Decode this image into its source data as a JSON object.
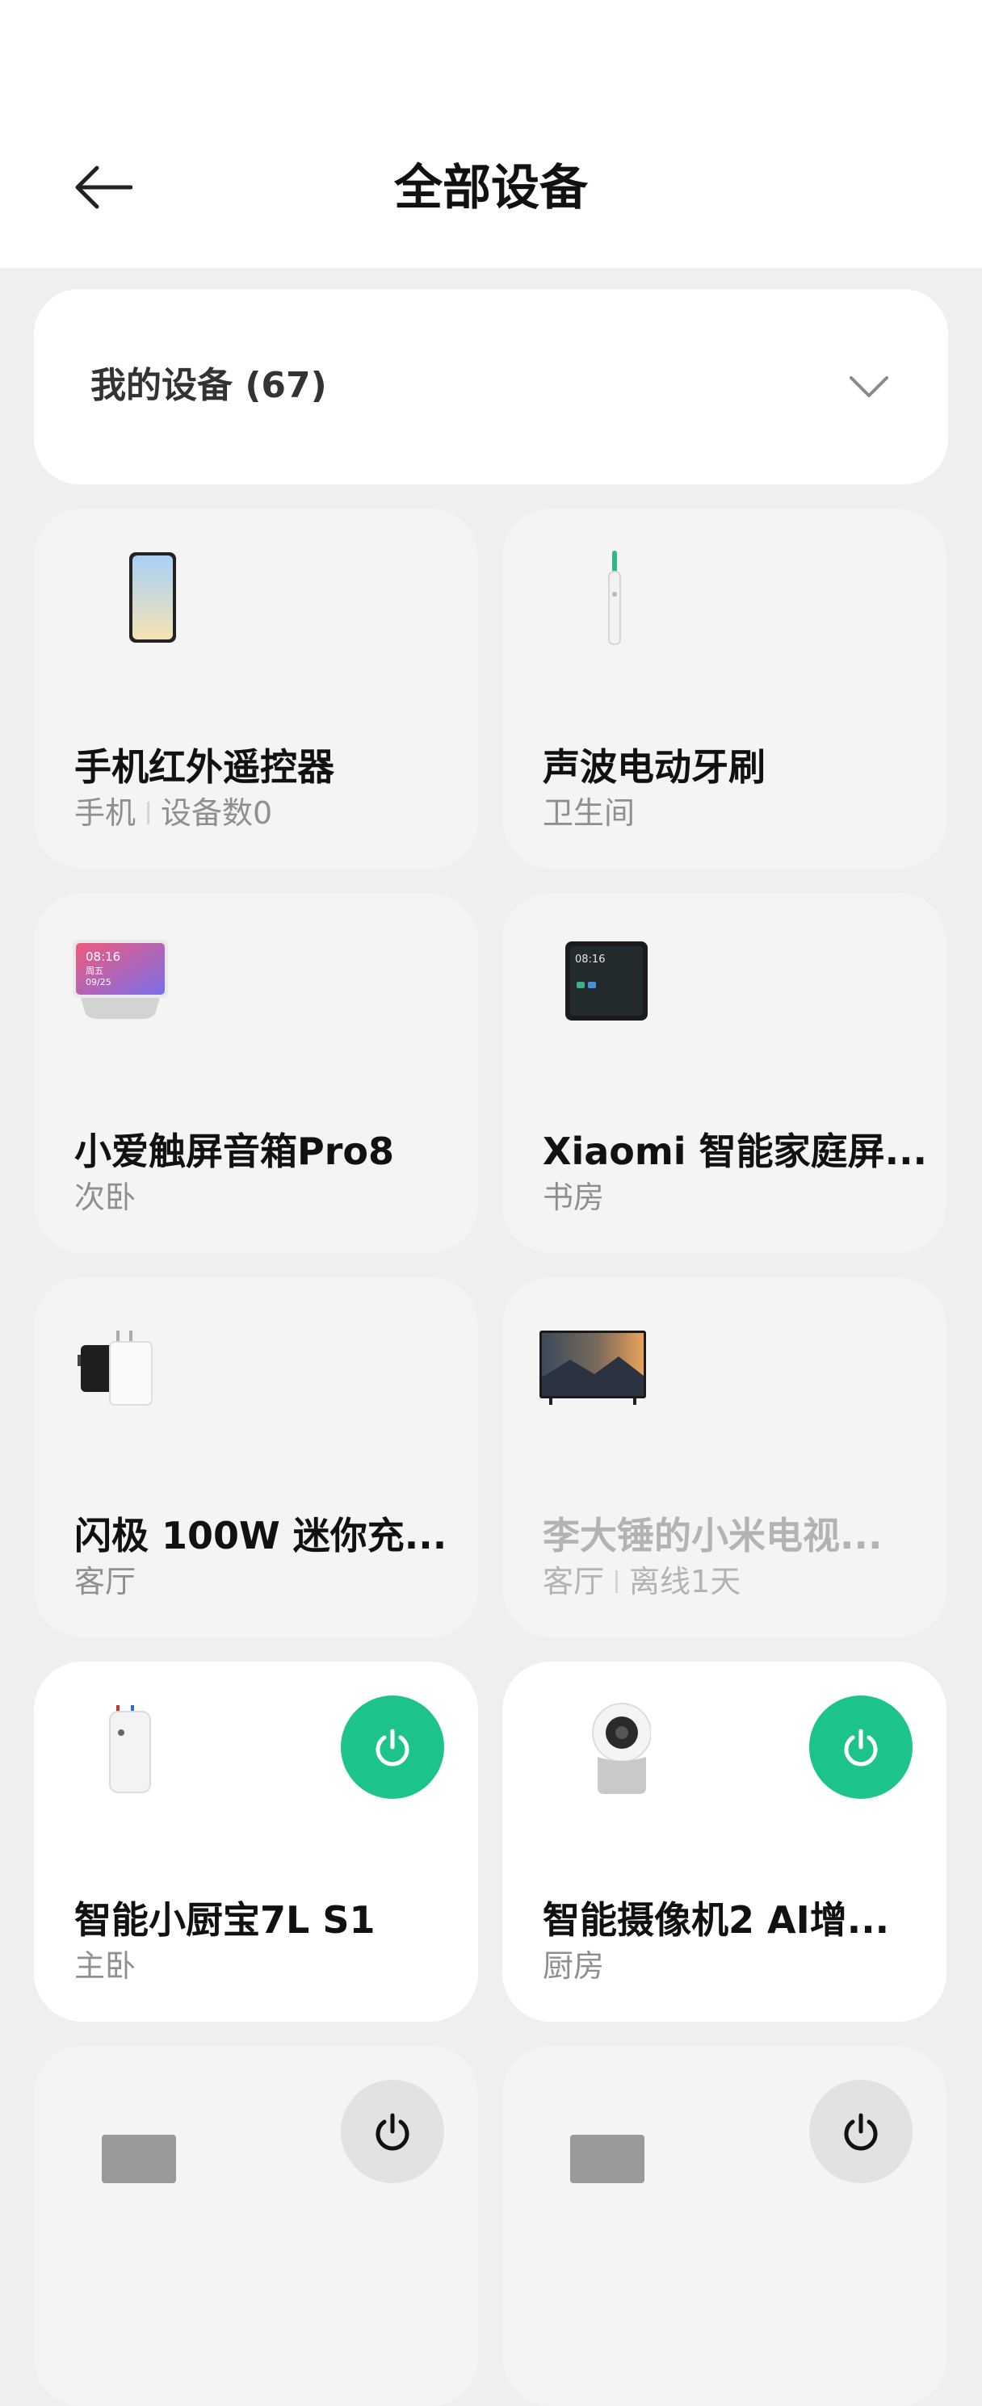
{
  "header": {
    "title": "全部设备"
  },
  "filter": {
    "label": "我的设备 (67)"
  },
  "devices": [
    {
      "name": "手机红外遥控器",
      "room": "手机",
      "extra": "设备数0",
      "icon": "phone-icon"
    },
    {
      "name": "声波电动牙刷",
      "room": "卫生间",
      "icon": "toothbrush-icon"
    },
    {
      "name": "小爱触屏音箱Pro8",
      "room": "次卧",
      "icon": "smart-display-speaker-icon",
      "screen_time": "08:16",
      "screen_day": "周五",
      "screen_date": "09/25"
    },
    {
      "name": "Xiaomi 智能家庭屏...",
      "room": "书房",
      "icon": "home-screen-icon",
      "screen_time": "08:16"
    },
    {
      "name": "闪极  100W 迷你充...",
      "room": "客厅",
      "icon": "charger-icon"
    },
    {
      "name": "李大锤的小米电视...",
      "room": "客厅",
      "extra": "离线1天",
      "icon": "tv-icon",
      "offline": true
    },
    {
      "name": "智能小厨宝7L S1",
      "room": "主卧",
      "icon": "water-heater-icon",
      "power": "on"
    },
    {
      "name": "智能摄像机2 AI增...",
      "room": "厨房",
      "icon": "camera-icon",
      "power": "on"
    },
    {
      "name": "",
      "room": "",
      "icon": "device-icon",
      "power": "off"
    },
    {
      "name": "",
      "room": "",
      "icon": "device-icon",
      "power": "off"
    }
  ],
  "colors": {
    "power_on": "#1cc48a",
    "background": "#efefef",
    "card": "#f4f4f4"
  }
}
